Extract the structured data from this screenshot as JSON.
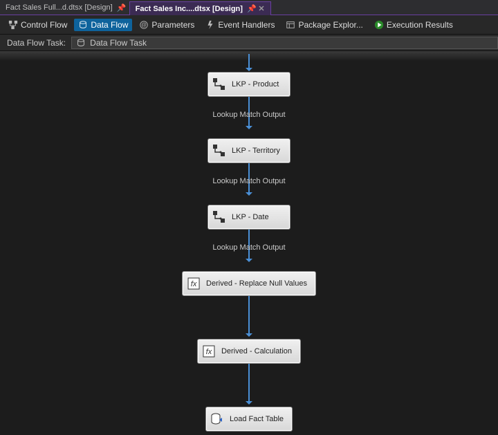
{
  "tabs": [
    {
      "label": "Fact Sales Full...d.dtsx [Design]",
      "active": false
    },
    {
      "label": "Fact Sales Inc....dtsx [Design]",
      "active": true
    }
  ],
  "subnav": {
    "control_flow": "Control Flow",
    "data_flow": "Data Flow",
    "parameters": "Parameters",
    "event_handlers": "Event Handlers",
    "package_explorer": "Package Explor...",
    "execution_results": "Execution Results"
  },
  "breadcrumb": {
    "label": "Data Flow Task:",
    "value": "Data Flow Task"
  },
  "nodes": {
    "lkp_product": "LKP - Product",
    "lkp_territory": "LKP - Territory",
    "lkp_date": "LKP - Date",
    "derived_replace": "Derived - Replace Null Values",
    "derived_calc": "Derived - Calculation",
    "load_fact": "Load Fact Table"
  },
  "edge_label": "Lookup Match Output"
}
